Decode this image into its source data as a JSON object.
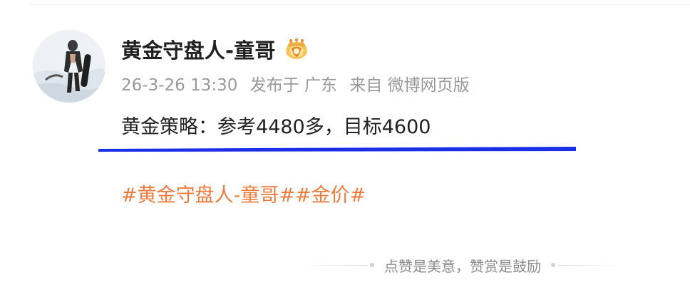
{
  "post": {
    "author": {
      "name": "黄金守盘人-童哥",
      "badge_icon": "crown-badge-icon"
    },
    "meta": {
      "time": "26-3-26 13:30",
      "location": "发布于 广东",
      "source": "来自 微博网页版"
    },
    "text": "黄金策略：参考4480多，目标4600",
    "hashtags": [
      "#黄金守盘人-童哥#",
      "#金价#"
    ],
    "reward_hint": "点赞是美意，赞赏是鼓励"
  },
  "colors": {
    "hashtag": "#ee7a3c",
    "underline_mark": "#1a2ee6",
    "meta_text": "#9a9a9a"
  }
}
